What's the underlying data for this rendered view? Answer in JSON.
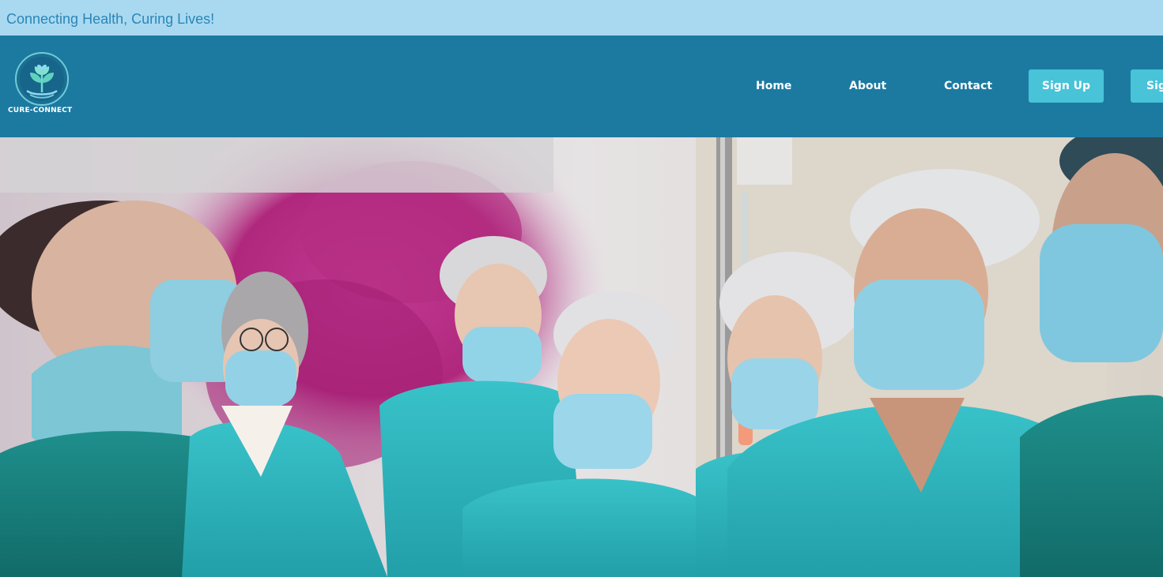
{
  "topbar": {
    "tagline": "Connecting Health, Curing Lives!"
  },
  "brand": {
    "name": "CURE-CONNECT",
    "logo_icon": "leaf-heart-icon"
  },
  "nav": {
    "home": "Home",
    "about": "About",
    "contact": "Contact",
    "signup": "Sign Up",
    "signin": "Sign In"
  },
  "colors": {
    "topbar_bg": "#a9d9f0",
    "nav_bg": "#1c7aa1",
    "button_bg": "#48c3d8",
    "scrubs": "#2fb7c2"
  },
  "hero": {
    "image": "medical-team-photo"
  }
}
